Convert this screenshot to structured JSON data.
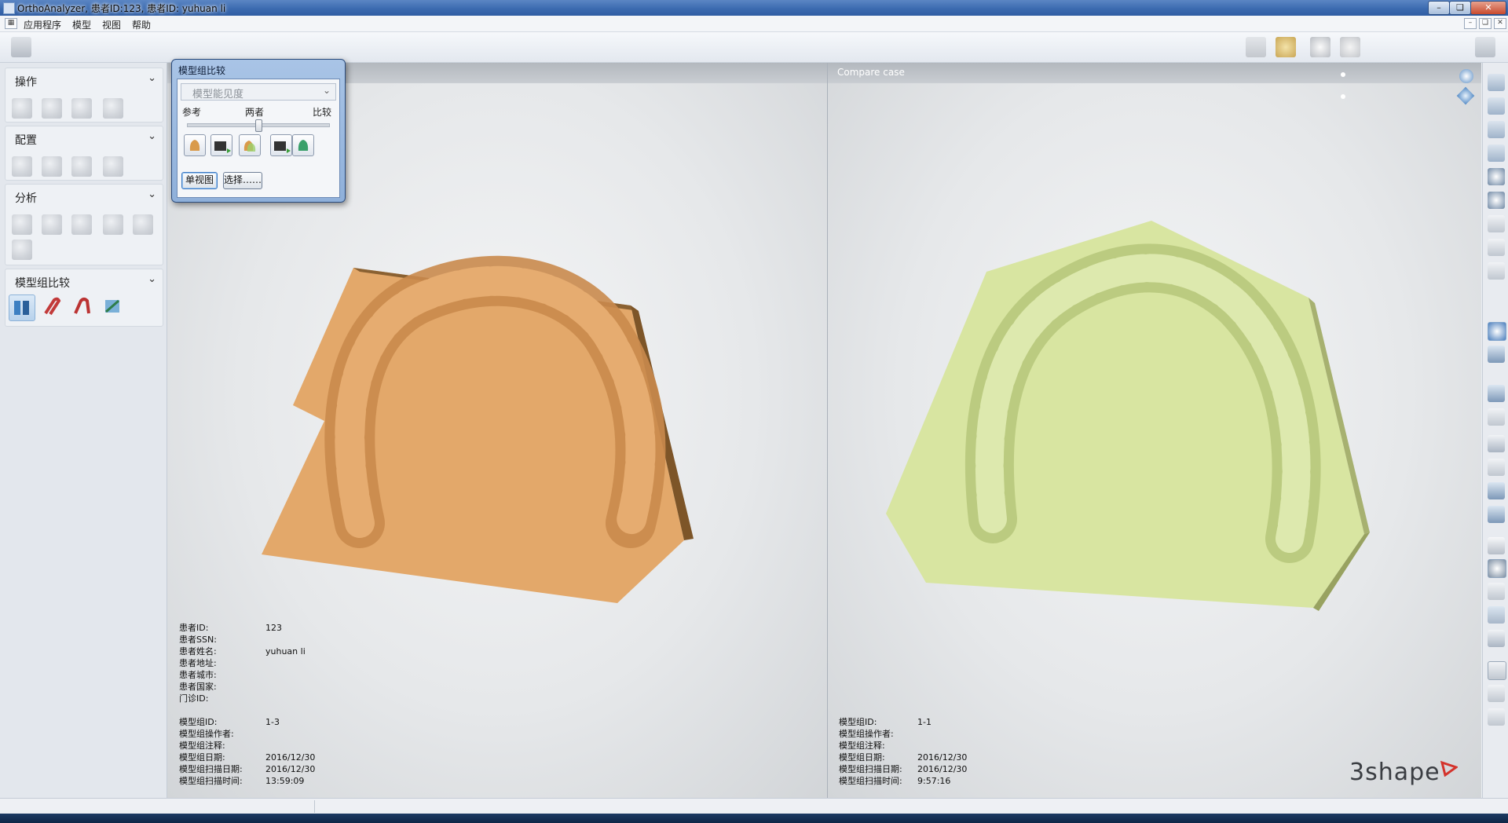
{
  "window": {
    "title": "OrthoAnalyzer, 患者ID:123, 患者ID: yuhuan li",
    "controls": [
      "minimize-icon",
      "restore-icon",
      "close-icon"
    ]
  },
  "menu": {
    "items": [
      "应用程序",
      "模型",
      "视图",
      "帮助"
    ]
  },
  "left_panel": {
    "sections": [
      {
        "title": "操作"
      },
      {
        "title": "配置"
      },
      {
        "title": "分析"
      },
      {
        "title": "模型组比较"
      }
    ]
  },
  "dialog": {
    "title": "模型组比较",
    "combo_value": "模型能见度",
    "slider_labels": [
      "参考",
      "两者",
      "比较"
    ],
    "slider_value_percent": 50,
    "buttons": [
      "单视图",
      "选择……"
    ]
  },
  "left_view": {
    "model_color": "#e3a86a",
    "info_rows": [
      {
        "label": "患者ID:",
        "value": "123"
      },
      {
        "label": "患者SSN:",
        "value": ""
      },
      {
        "label": "患者姓名:",
        "value": "yuhuan li"
      },
      {
        "label": "患者地址:",
        "value": ""
      },
      {
        "label": "患者城市:",
        "value": ""
      },
      {
        "label": "患者国家:",
        "value": ""
      },
      {
        "label": "门诊ID:",
        "value": ""
      }
    ],
    "case_rows": [
      {
        "label": "模型组ID:",
        "value": "1-3"
      },
      {
        "label": "模型组操作者:",
        "value": ""
      },
      {
        "label": "模型组注释:",
        "value": ""
      },
      {
        "label": "模型组日期:",
        "value": "2016/12/30"
      },
      {
        "label": "模型组扫描日期:",
        "value": "2016/12/30"
      },
      {
        "label": "模型组扫描时间:",
        "value": "13:59:09"
      }
    ]
  },
  "right_view": {
    "caption": "Compare case",
    "model_color": "#d6e39e",
    "case_rows": [
      {
        "label": "模型组ID:",
        "value": "1-1"
      },
      {
        "label": "模型组操作者:",
        "value": ""
      },
      {
        "label": "模型组注释:",
        "value": ""
      },
      {
        "label": "模型组日期:",
        "value": "2016/12/30"
      },
      {
        "label": "模型组扫描日期:",
        "value": "2016/12/30"
      },
      {
        "label": "模型组扫描时间:",
        "value": "9:57:16"
      }
    ]
  },
  "brand": "3shape"
}
